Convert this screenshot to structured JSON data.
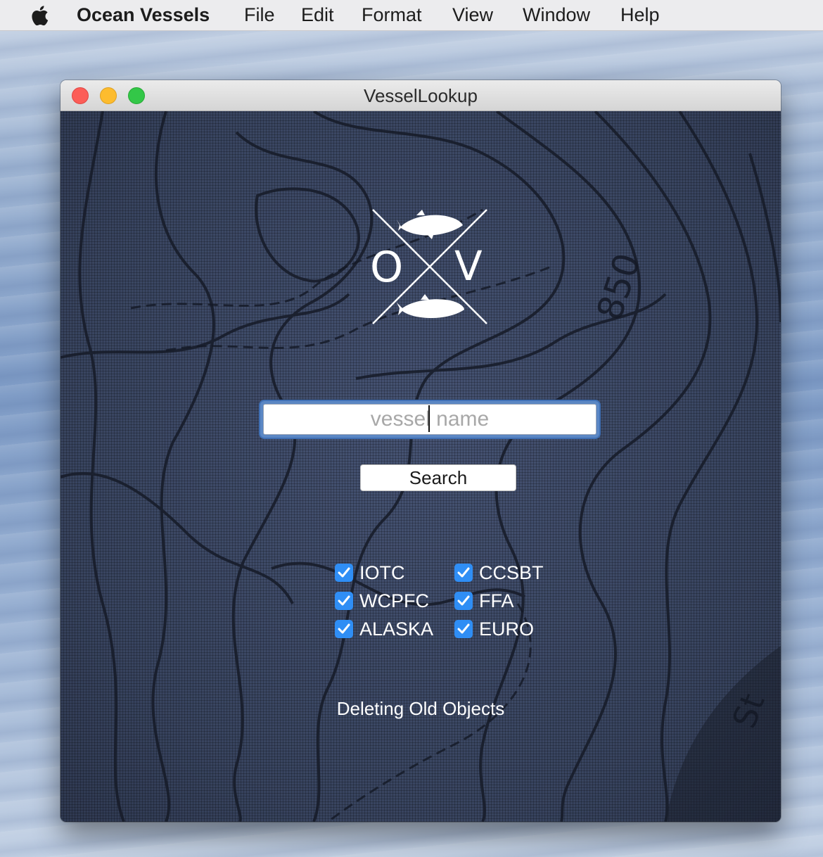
{
  "menubar": {
    "app_name": "Ocean Vessels",
    "items": [
      "File",
      "Edit",
      "Format",
      "View",
      "Window",
      "Help"
    ],
    "apple_icon": "apple-icon"
  },
  "window": {
    "title": "VesselLookup",
    "controls": [
      "close",
      "minimize",
      "zoom"
    ]
  },
  "logo": {
    "letters": [
      "O",
      "V"
    ],
    "icons": [
      "tuna-fish-icon",
      "salmon-fish-icon"
    ]
  },
  "search": {
    "placeholder": "vessel name",
    "value": "",
    "button_label": "Search"
  },
  "filters": [
    {
      "label": "IOTC",
      "checked": true
    },
    {
      "label": "CCSBT",
      "checked": true
    },
    {
      "label": "WCPFC",
      "checked": true
    },
    {
      "label": "FFA",
      "checked": true
    },
    {
      "label": "ALASKA",
      "checked": true
    },
    {
      "label": "EURO",
      "checked": true
    }
  ],
  "status_text": "Deleting Old Objects",
  "colors": {
    "background_navy": "#3b4766",
    "checkbox_blue": "#2f8ef5",
    "focus_ring": "#5b87c4"
  }
}
